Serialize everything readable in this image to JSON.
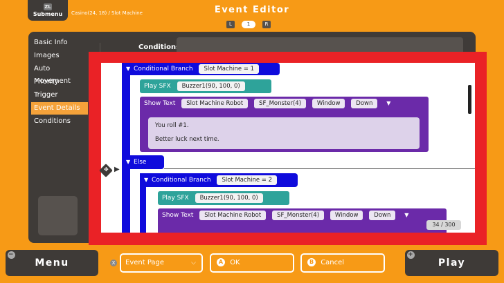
{
  "header": {
    "submenu_badge": "ZL",
    "submenu_label": "Submenu",
    "breadcrumb": "Casino(24, 18) / Slot Machine",
    "title": "Event Editor",
    "pager_left": "L",
    "pager_current": "1",
    "pager_right": "R"
  },
  "sidebar": {
    "items": [
      {
        "label": "Basic Info"
      },
      {
        "label": "Images"
      },
      {
        "label": "Auto Movement"
      },
      {
        "label": "Priority"
      },
      {
        "label": "Trigger"
      },
      {
        "label": "Event Details"
      },
      {
        "label": "Conditions"
      }
    ],
    "active_index": 5
  },
  "conditions_label": "Conditions",
  "editor": {
    "commands": {
      "cb1_label": "Conditional Branch",
      "cb1_arg": "Slot Machine = 1",
      "sfx1_label": "Play SFX",
      "sfx1_arg": "Buzzer1(90, 100, 0)",
      "st1_label": "Show Text",
      "st1_speaker": "Slot Machine Robot",
      "st1_face": "SF_Monster(4)",
      "st1_window": "Window",
      "st1_pos": "Down",
      "st1_line1": "You roll #1.",
      "st1_line2": "Better luck next time.",
      "else_label": "Else",
      "cb2_label": "Conditional Branch",
      "cb2_arg": "Slot Machine = 2",
      "sfx2_label": "Play SFX",
      "sfx2_arg": "Buzzer1(90, 100, 0)",
      "st2_label": "Show Text",
      "st2_speaker": "Slot Machine Robot",
      "st2_face": "SF_Monster(4)",
      "st2_window": "Window",
      "st2_pos": "Down"
    },
    "counter": "34 / 300"
  },
  "footer": {
    "menu_corner": "−",
    "menu_label": "Menu",
    "x_badge": "X",
    "event_page_label": "Event Page",
    "ok_key": "A",
    "ok_label": "OK",
    "cancel_key": "B",
    "cancel_label": "Cancel",
    "play_corner": "+",
    "play_label": "Play"
  },
  "colors": {
    "background": "#f79a16",
    "panel": "#3f3b38",
    "branch_blue": "#0f0bdc",
    "sfx_teal": "#2ea39a",
    "text_purple": "#6b2aa9",
    "highlight_red": "#ea2226",
    "active_nav": "#f5a23a"
  }
}
